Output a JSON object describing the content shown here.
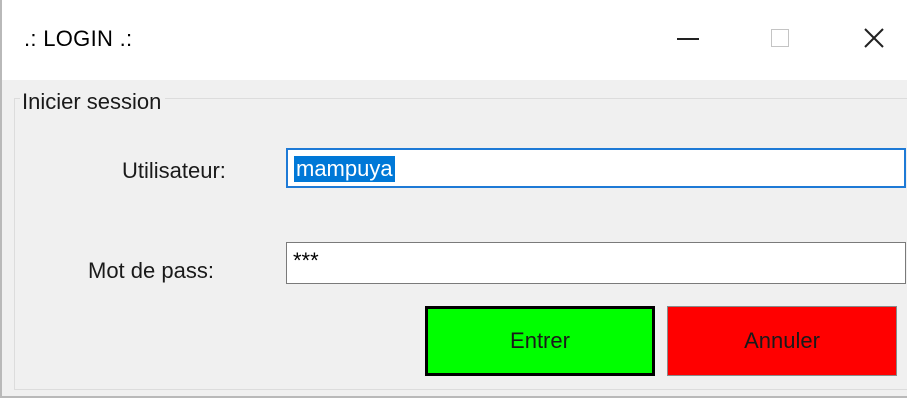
{
  "window": {
    "title": ".: LOGIN .:",
    "controls": {
      "minimize_icon": "minimize-icon",
      "maximize_icon": "maximize-icon",
      "close_icon": "close-icon",
      "close_glyph": "✕"
    }
  },
  "group": {
    "legend": "Inicier session"
  },
  "form": {
    "user_label": "Utilisateur:",
    "user_value": "mampuya",
    "pass_label": "Mot de pass:",
    "pass_value": "***"
  },
  "buttons": {
    "enter_label": "Entrer",
    "cancel_label": "Annuler"
  },
  "colors": {
    "enter_bg": "#00ff00",
    "cancel_bg": "#ff0000",
    "selection": "#0078d7",
    "focus_border": "#1e7ad6"
  }
}
